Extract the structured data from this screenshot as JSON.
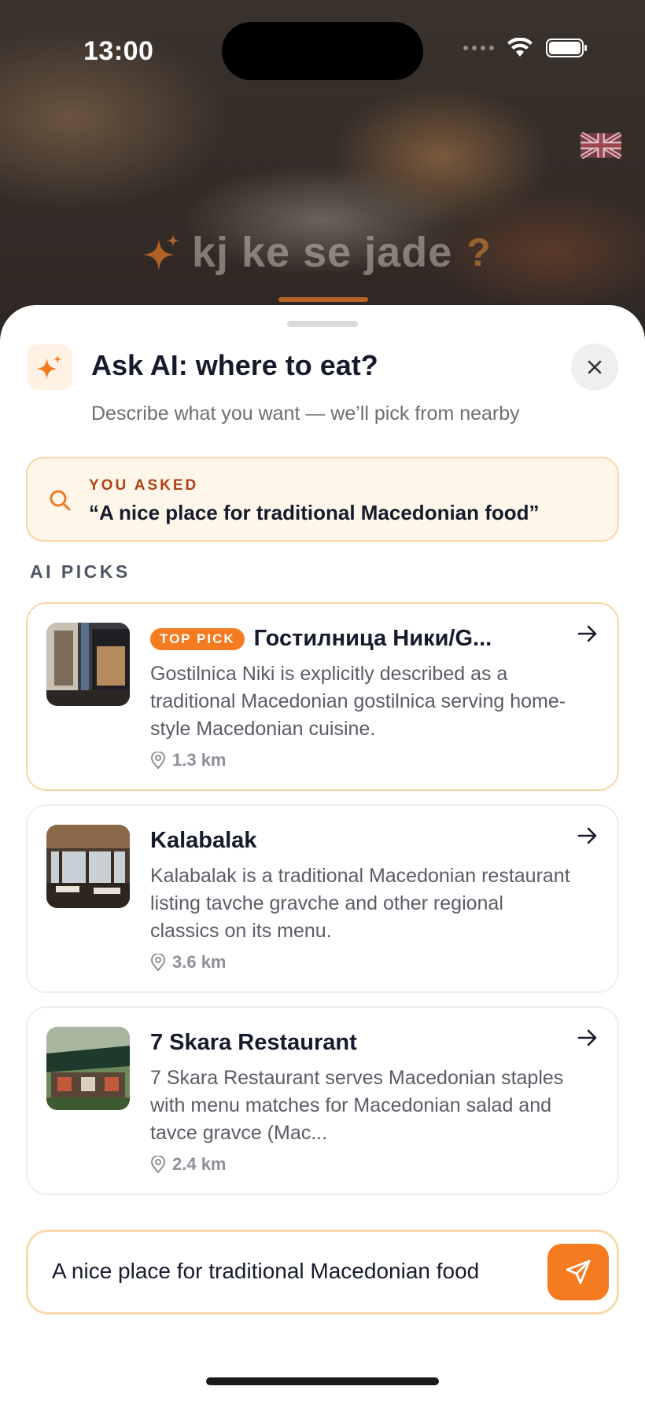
{
  "status_bar": {
    "time": "13:00"
  },
  "hero": {
    "title": "kj ke se jade",
    "suffix": "?"
  },
  "sheet": {
    "title": "Ask AI: where to eat?",
    "subtitle": "Describe what you want — we’ll pick from nearby"
  },
  "asked": {
    "label": "YOU ASKED",
    "query": "“A nice place for traditional Macedonian food”"
  },
  "section_label": "AI PICKS",
  "picks": [
    {
      "badge": "TOP PICK",
      "name": "Гостилница Ники/G...",
      "description": "Gostilnica Niki is explicitly described as a traditional Macedonian gostilnica serving home-style Macedonian cuisine.",
      "distance": "1.3 km"
    },
    {
      "name": "Kalabalak",
      "description": "Kalabalak is a traditional Macedonian restaurant listing tavche gravche and other regional classics on its menu.",
      "distance": "3.6 km"
    },
    {
      "name": "7 Skara Restaurant",
      "description": "7 Skara Restaurant serves Macedonian staples with menu matches for Macedonian salad and tavce gravce (Mac...",
      "distance": "2.4 km"
    }
  ],
  "input": {
    "value": "A nice place for traditional Macedonian food"
  },
  "colors": {
    "accent": "#f47b20",
    "title": "#151a2c",
    "asked_bg": "#fff6ea"
  }
}
